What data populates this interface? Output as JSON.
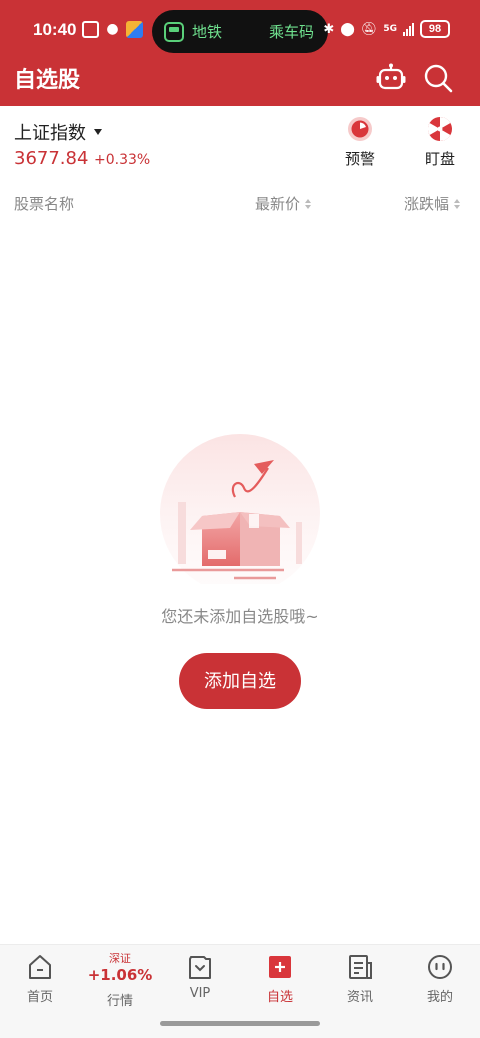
{
  "status_bar": {
    "time": "10:40",
    "island_left": "地铁",
    "island_right": "乘车码",
    "network": "5G",
    "battery": "98"
  },
  "header": {
    "title": "自选股"
  },
  "index": {
    "name": "上证指数",
    "value": "3677.84",
    "change": "+0.33%"
  },
  "tools": [
    {
      "label": "预警"
    },
    {
      "label": "盯盘"
    }
  ],
  "columns": {
    "name": "股票名称",
    "price": "最新价",
    "change": "涨跌幅"
  },
  "empty_state": {
    "message": "您还未添加自选股哦~",
    "button": "添加自选"
  },
  "tabbar": {
    "home": "首页",
    "market": {
      "label": "行情",
      "sub": "深证",
      "value": "+1.06%"
    },
    "vip": "VIP",
    "watchlist": "自选",
    "news": "资讯",
    "mine": "我的"
  },
  "colors": {
    "brand": "#c93236",
    "text": "#222222",
    "muted": "#888888"
  },
  "icons": [
    "robot-icon",
    "search-icon",
    "alert-icon",
    "monitor-icon",
    "home-icon",
    "vip-icon",
    "add-icon",
    "news-icon",
    "profile-icon"
  ]
}
